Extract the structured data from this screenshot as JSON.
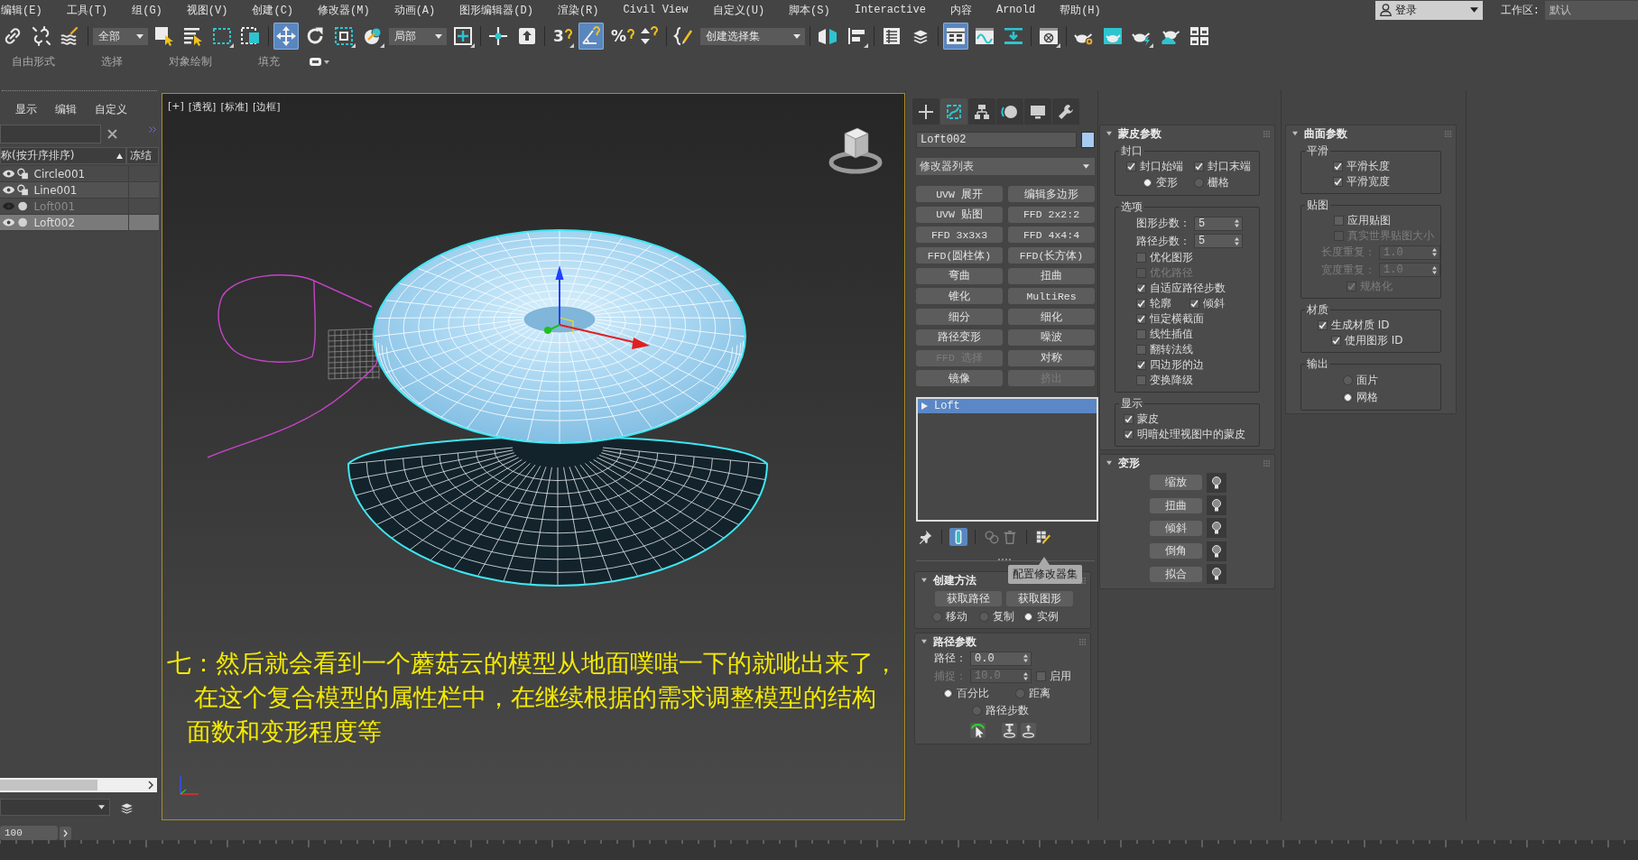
{
  "menu_bar": {
    "items": [
      "编辑(E)",
      "工具(T)",
      "组(G)",
      "视图(V)",
      "创建(C)",
      "修改器(M)",
      "动画(A)",
      "图形编辑器(D)",
      "渲染(R)",
      "Civil View",
      "自定义(U)",
      "脚本(S)",
      "Interactive",
      "内容",
      "Arnold",
      "帮助(H)"
    ],
    "login": "登录",
    "workspace_label": "工作区:",
    "workspace": "默认"
  },
  "toolbar": {
    "groups": [
      [
        {
          "kind": "button",
          "on": false,
          "flyout": false
        },
        {
          "kind": "button",
          "on": false,
          "flyout": false
        },
        {
          "kind": "button",
          "on": false,
          "flyout": false
        }
      ],
      [
        {
          "kind": "dropdown",
          "value": "全部"
        },
        {
          "kind": "button",
          "on": false,
          "flyout": false
        },
        {
          "kind": "button",
          "on": false,
          "flyout": false
        },
        {
          "kind": "button",
          "on": false,
          "flyout": true
        },
        {
          "kind": "button",
          "on": false,
          "flyout": false
        }
      ],
      [
        {
          "kind": "button",
          "on": true,
          "flyout": false
        },
        {
          "kind": "button",
          "on": false,
          "flyout": false
        },
        {
          "kind": "button",
          "on": false,
          "flyout": true
        },
        {
          "kind": "button",
          "on": false,
          "flyout": true
        },
        {
          "kind": "dropdown",
          "value": "局部"
        },
        {
          "kind": "button",
          "on": false,
          "flyout": true
        }
      ],
      [
        {
          "kind": "button",
          "on": false,
          "flyout": false
        },
        {
          "kind": "button",
          "on": false,
          "flyout": false
        }
      ],
      [
        {
          "kind": "button",
          "label": "3",
          "on": false,
          "flyout": true
        },
        {
          "kind": "button",
          "on": true,
          "flyout": false
        },
        {
          "kind": "button",
          "label": "%",
          "on": false,
          "flyout": false
        },
        {
          "kind": "button",
          "on": false,
          "flyout": false
        }
      ],
      [
        {
          "kind": "button",
          "on": false,
          "flyout": false
        },
        {
          "kind": "dropdown",
          "value": "创建选择集"
        }
      ],
      [
        {
          "kind": "button",
          "on": false,
          "flyout": false
        },
        {
          "kind": "button",
          "on": false,
          "flyout": true
        }
      ],
      [
        {
          "kind": "button",
          "on": false,
          "flyout": false
        },
        {
          "kind": "button",
          "on": false,
          "flyout": false
        }
      ],
      [
        {
          "kind": "button",
          "on": true,
          "flyout": false
        },
        {
          "kind": "button",
          "on": false,
          "flyout": false
        },
        {
          "kind": "button",
          "on": false,
          "flyout": false
        }
      ],
      [
        {
          "kind": "button",
          "on": false,
          "flyout": true
        }
      ],
      [
        {
          "kind": "button",
          "on": false,
          "flyout": false
        },
        {
          "kind": "button",
          "on": false,
          "flyout": false
        },
        {
          "kind": "button",
          "on": false,
          "flyout": true
        },
        {
          "kind": "button",
          "on": false,
          "flyout": false
        },
        {
          "kind": "button",
          "on": false,
          "flyout": false
        }
      ]
    ]
  },
  "ribbon": {
    "tabs": [
      {
        "label": "自由形式",
        "selected": false
      },
      {
        "label": "选择",
        "selected": false
      },
      {
        "label": "对象绘制",
        "selected": false
      },
      {
        "label": "填充",
        "selected": false
      }
    ]
  },
  "scene_explorer": {
    "menu": [
      "显示",
      "编辑",
      "自定义"
    ],
    "columns": [
      "称(按升序排序)",
      "冻结"
    ],
    "rows": [
      {
        "name": "Circle001",
        "kind": "shape",
        "visible": true,
        "selected": false
      },
      {
        "name": "Line001",
        "kind": "shape",
        "visible": true,
        "selected": false
      },
      {
        "name": "Loft001",
        "kind": "geometry",
        "visible": false,
        "selected": false
      },
      {
        "name": "Loft002",
        "kind": "geometry",
        "visible": true,
        "selected": true
      }
    ]
  },
  "viewport": {
    "labels": [
      "[+]",
      "[透视]",
      "[标准]",
      "[边框]"
    ],
    "caption": [
      "七：然后就会看到一个蘑菇云的模型从地面噗嗤一下的就呲出来了，",
      "在这个复合模型的属性栏中，在继续根据的需求调整模型的结构",
      "面数和变形程度等"
    ]
  },
  "command_panel": {
    "tabs": [
      {
        "selected": false
      },
      {
        "selected": true
      },
      {
        "selected": false
      },
      {
        "selected": false
      },
      {
        "selected": false
      },
      {
        "selected": false
      }
    ],
    "object_name": "Loft002",
    "modifier_list": "修改器列表",
    "modifier_buttons": [
      {
        "label": "UVW 展开",
        "disabled": false
      },
      {
        "label": "编辑多边形",
        "disabled": false
      },
      {
        "label": "UVW 贴图",
        "disabled": false
      },
      {
        "label": "FFD 2x2:2",
        "disabled": false
      },
      {
        "label": "FFD 3x3x3",
        "disabled": false
      },
      {
        "label": "FFD 4x4:4",
        "disabled": false
      },
      {
        "label": "FFD(圆柱体)",
        "disabled": false
      },
      {
        "label": "FFD(长方体)",
        "disabled": false
      },
      {
        "label": "弯曲",
        "disabled": false
      },
      {
        "label": "扭曲",
        "disabled": false
      },
      {
        "label": "锥化",
        "disabled": false
      },
      {
        "label": "MultiRes",
        "disabled": false
      },
      {
        "label": "细分",
        "disabled": false
      },
      {
        "label": "细化",
        "disabled": false
      },
      {
        "label": "路径变形",
        "disabled": false
      },
      {
        "label": "噪波",
        "disabled": false
      },
      {
        "label": "FFD 选择",
        "disabled": true
      },
      {
        "label": "对称",
        "disabled": false
      },
      {
        "label": "镜像",
        "disabled": false
      },
      {
        "label": "挤出",
        "disabled": true
      }
    ],
    "stack": [
      {
        "label": "Loft",
        "selected": true
      }
    ],
    "stack_tools": [
      {
        "on": false,
        "disabled": false
      },
      {
        "on": true,
        "disabled": false
      },
      {
        "on": false,
        "disabled": true
      },
      {
        "on": false,
        "disabled": true
      },
      {
        "on": false,
        "disabled": false
      }
    ],
    "tooltip": "配置修改器集",
    "rollout_columns": [
      [
        {
          "title": "创建方法",
          "expanded": true,
          "groups": [
            {
              "rows": [
                [
                  {
                    "kind": "button",
                    "label": "获取路径"
                  },
                  {
                    "kind": "button",
                    "label": "获取图形"
                  }
                ]
              ]
            },
            {
              "rows": [
                [
                  {
                    "kind": "radio",
                    "label": "移动",
                    "selected": false,
                    "disabled": false
                  },
                  {
                    "kind": "radio",
                    "label": "复制",
                    "selected": false,
                    "disabled": false
                  },
                  {
                    "kind": "radio",
                    "label": "实例",
                    "selected": true,
                    "disabled": false
                  }
                ]
              ]
            }
          ]
        },
        {
          "title": "路径参数",
          "expanded": true,
          "groups": [
            {
              "rows": [
                [
                  {
                    "kind": "spinner",
                    "label": "路径：",
                    "value": "0.0",
                    "disabled": false
                  }
                ],
                [
                  {
                    "kind": "spinner",
                    "label": "捕捉：",
                    "value": "10.0",
                    "disabled": true
                  },
                  {
                    "kind": "checkbox",
                    "label": "启用",
                    "checked": false,
                    "disabled": false
                  }
                ],
                [
                  {
                    "kind": "radio",
                    "label": "百分比",
                    "selected": true,
                    "disabled": false
                  },
                  {
                    "kind": "radio",
                    "label": "距离",
                    "selected": false,
                    "disabled": false
                  }
                ],
                [
                  {
                    "kind": "radio",
                    "label": "路径步数",
                    "selected": false,
                    "disabled": false
                  }
                ],
                [
                  {
                    "kind": "tool"
                  },
                  {
                    "kind": "tool"
                  },
                  {
                    "kind": "tool"
                  }
                ]
              ]
            }
          ]
        }
      ],
      [
        {
          "title": "蒙皮参数",
          "expanded": true,
          "groups": [
            {
              "label": "封口",
              "rows": [
                [
                  {
                    "kind": "checkbox",
                    "label": "封口始端",
                    "checked": true,
                    "disabled": false
                  },
                  {
                    "kind": "checkbox",
                    "label": "封口末端",
                    "checked": true,
                    "disabled": false
                  }
                ],
                [
                  {
                    "kind": "radio",
                    "label": "变形",
                    "selected": true,
                    "disabled": false
                  },
                  {
                    "kind": "radio",
                    "label": "栅格",
                    "selected": false,
                    "disabled": false
                  }
                ]
              ]
            },
            {
              "label": "选项",
              "rows": [
                [
                  {
                    "kind": "spinner",
                    "label": "图形步数：",
                    "value": "5",
                    "disabled": false
                  }
                ],
                [
                  {
                    "kind": "spinner",
                    "label": "路径步数：",
                    "value": "5",
                    "disabled": false
                  }
                ],
                [
                  {
                    "kind": "checkbox",
                    "label": "优化图形",
                    "checked": false,
                    "disabled": false
                  }
                ],
                [
                  {
                    "kind": "checkbox",
                    "label": "优化路径",
                    "checked": false,
                    "disabled": true
                  }
                ],
                [
                  {
                    "kind": "checkbox",
                    "label": "自适应路径步数",
                    "checked": true,
                    "disabled": false
                  }
                ],
                [
                  {
                    "kind": "checkbox",
                    "label": "轮廓",
                    "checked": true,
                    "disabled": false
                  },
                  {
                    "kind": "checkbox",
                    "label": "倾斜",
                    "checked": true,
                    "disabled": false
                  }
                ],
                [
                  {
                    "kind": "checkbox",
                    "label": "恒定横截面",
                    "checked": true,
                    "disabled": false
                  }
                ],
                [
                  {
                    "kind": "checkbox",
                    "label": "线性插值",
                    "checked": false,
                    "disabled": false
                  }
                ],
                [
                  {
                    "kind": "checkbox",
                    "label": "翻转法线",
                    "checked": false,
                    "disabled": false
                  }
                ],
                [
                  {
                    "kind": "checkbox",
                    "label": "四边形的边",
                    "checked": true,
                    "disabled": false
                  }
                ],
                [
                  {
                    "kind": "checkbox",
                    "label": "变换降级",
                    "checked": false,
                    "disabled": false
                  }
                ]
              ]
            },
            {
              "label": "显示",
              "rows": [
                [
                  {
                    "kind": "checkbox",
                    "label": "蒙皮",
                    "checked": true,
                    "disabled": false
                  }
                ],
                [
                  {
                    "kind": "checkbox",
                    "label": "明暗处理视图中的蒙皮",
                    "checked": true,
                    "disabled": false
                  }
                ]
              ]
            }
          ]
        },
        {
          "title": "变形",
          "expanded": true,
          "groups": [
            {
              "rows": [
                [
                  {
                    "kind": "deform",
                    "label": "缩放"
                  }
                ],
                [
                  {
                    "kind": "deform",
                    "label": "扭曲"
                  }
                ],
                [
                  {
                    "kind": "deform",
                    "label": "倾斜"
                  }
                ],
                [
                  {
                    "kind": "deform",
                    "label": "倒角"
                  }
                ],
                [
                  {
                    "kind": "deform",
                    "label": "拟合"
                  }
                ]
              ]
            }
          ]
        }
      ],
      [
        {
          "title": "曲面参数",
          "expanded": true,
          "groups": [
            {
              "label": "平滑",
              "rows": [
                [
                  {
                    "kind": "checkbox",
                    "label": "平滑长度",
                    "checked": true,
                    "disabled": false
                  }
                ],
                [
                  {
                    "kind": "checkbox",
                    "label": "平滑宽度",
                    "checked": true,
                    "disabled": false
                  }
                ]
              ]
            },
            {
              "label": "贴图",
              "rows": [
                [
                  {
                    "kind": "checkbox",
                    "label": "应用贴图",
                    "checked": false,
                    "disabled": false
                  }
                ],
                [
                  {
                    "kind": "checkbox",
                    "label": "真实世界贴图大小",
                    "checked": false,
                    "disabled": true
                  }
                ],
                [
                  {
                    "kind": "spinner",
                    "label": "长度重复：",
                    "value": "1.0",
                    "disabled": true
                  }
                ],
                [
                  {
                    "kind": "spinner",
                    "label": "宽度重复：",
                    "value": "1.0",
                    "disabled": true
                  }
                ],
                [
                  {
                    "kind": "checkbox",
                    "label": "规格化",
                    "checked": true,
                    "disabled": true
                  }
                ]
              ]
            },
            {
              "label": "材质",
              "rows": [
                [
                  {
                    "kind": "checkbox",
                    "label": "生成材质 ID",
                    "checked": true,
                    "disabled": false
                  }
                ],
                [
                  {
                    "kind": "checkbox",
                    "label": "使用图形 ID",
                    "checked": true,
                    "disabled": false
                  }
                ]
              ]
            },
            {
              "label": "输出",
              "rows": [
                [
                  {
                    "kind": "radio",
                    "label": "面片",
                    "selected": false,
                    "disabled": false
                  }
                ],
                [
                  {
                    "kind": "radio",
                    "label": "网格",
                    "selected": true,
                    "disabled": false
                  }
                ]
              ]
            }
          ]
        }
      ]
    ]
  },
  "timeline": {
    "frame": "100"
  }
}
